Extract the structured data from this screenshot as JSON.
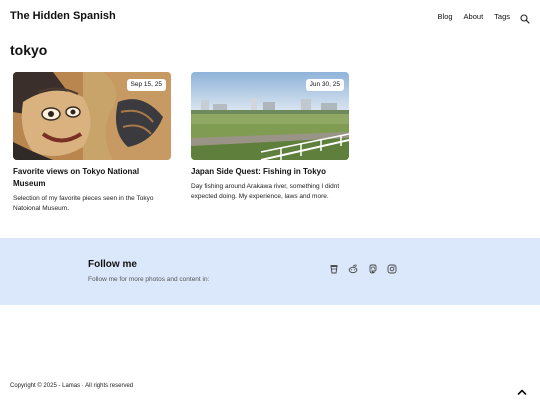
{
  "header": {
    "site_title": "The Hidden Spanish",
    "nav": [
      "Blog",
      "About",
      "Tags"
    ],
    "search_icon": "search-icon"
  },
  "page": {
    "title": "tokyo"
  },
  "posts": [
    {
      "date": "Sep 15, 25",
      "title": "Favorite views on Tokyo National Museum",
      "description": "Selection of my favorite pieces seen in the Tokyo Natoional Museum."
    },
    {
      "date": "Jun 30, 25",
      "title": "Japan Side Quest: Fishing in Tokyo",
      "description": "Day fishing around Arakawa river, something I didnt expected doing. My experience, laws and more."
    }
  ],
  "follow": {
    "title": "Follow me",
    "subtitle": "Follow me for more photos and content in:",
    "icons": [
      "coffee-cup-icon",
      "reddit-icon",
      "mastodon-icon",
      "instagram-icon"
    ],
    "background": "#dbe8fb"
  },
  "footer": {
    "copyright": "Copyright © 2025 - Lamas · All rights reserved",
    "to_top_icon": "chevron-up-icon"
  }
}
